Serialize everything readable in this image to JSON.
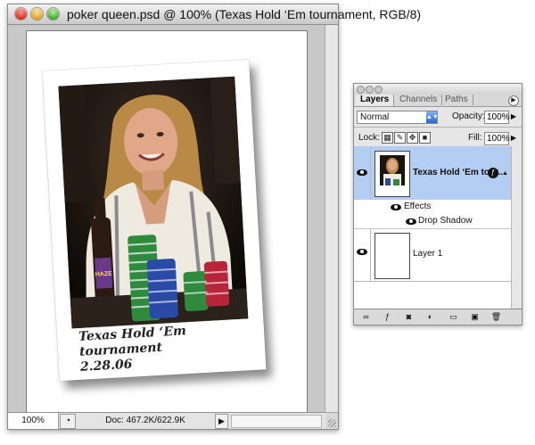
{
  "document_window": {
    "title": "poker queen.psd @ 100% (Texas Hold ‘Em tournament, RGB/8)",
    "status": {
      "zoom": "100%",
      "doc_info": "Doc: 467.2K/622.9K",
      "arrow": "▶"
    },
    "icons": [
      "close-button",
      "minimize-button",
      "zoom-button",
      "status-options-icon"
    ]
  },
  "photo": {
    "caption_line1": "Texas Hold ‘Em tournament",
    "caption_line2": "2.28.06",
    "beer_label": "HAZE"
  },
  "layers_panel": {
    "tabs": [
      "Layers",
      "Channels",
      "Paths"
    ],
    "blend_mode": "Normal",
    "opacity_label": "Opacity:",
    "opacity_value": "100%",
    "lock_label": "Lock:",
    "fill_label": "Fill:",
    "fill_value": "100%",
    "layers": [
      {
        "name": "Texas Hold ‘Em tour...",
        "selected": true,
        "has_effects": true
      },
      {
        "name": "Layer 1",
        "selected": false,
        "has_effects": false
      }
    ],
    "effects_label": "Effects",
    "drop_shadow_label": "Drop Shadow",
    "footer_icons": [
      "link-layers-icon",
      "add-style-icon",
      "add-mask-icon",
      "adjustment-layer-icon",
      "new-group-icon",
      "new-layer-icon",
      "delete-layer-icon"
    ]
  },
  "colors": {
    "selection_blue": "#b4cdf2",
    "select_blue": "#2a69d6",
    "chrome_gray": "#c8c8c8"
  }
}
